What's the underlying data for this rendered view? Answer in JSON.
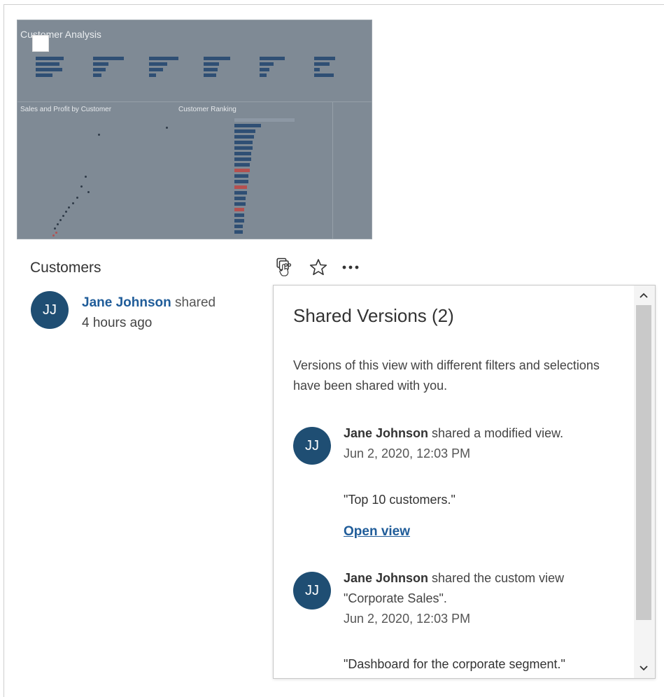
{
  "card": {
    "title": "Customers",
    "owner": {
      "initials": "JJ",
      "name": "Jane Johnson",
      "verb": "shared",
      "time": "4 hours ago"
    },
    "thumbnail": {
      "title": "Customer Analysis",
      "section_left": "Sales and Profit by Customer",
      "section_mid": "Customer Ranking"
    }
  },
  "toolbar": {
    "icons": [
      "shared-versions-icon",
      "favorite-star-icon",
      "more-actions-icon"
    ]
  },
  "popup": {
    "title": "Shared Versions (2)",
    "description": "Versions of this view with different filters and selections have been shared with you.",
    "entries": [
      {
        "initials": "JJ",
        "name": "Jane Johnson",
        "action": "shared a modified view.",
        "date": "Jun 2, 2020, 12:03 PM",
        "comment": "\"Top 10 customers.\"",
        "link": "Open view"
      },
      {
        "initials": "JJ",
        "name": "Jane Johnson",
        "action": "shared the custom view \"Corporate Sales\".",
        "date": "Jun 2, 2020, 12:03 PM",
        "comment": "\"Dashboard for the corporate segment.\""
      }
    ]
  },
  "colors": {
    "avatar": "#1f4e73",
    "link": "#1f5c99"
  }
}
